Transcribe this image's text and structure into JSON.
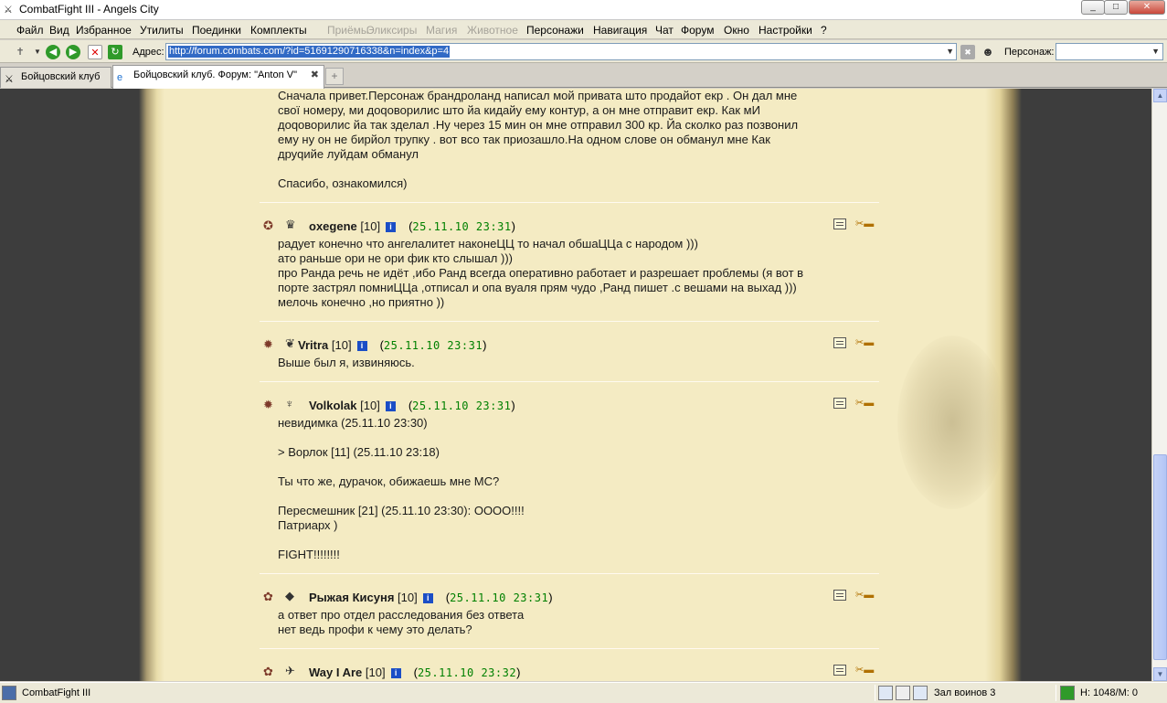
{
  "window": {
    "title": "CombatFight III - Angels City",
    "min": "_",
    "max": "□",
    "close": "✕"
  },
  "menu": {
    "items": [
      {
        "label": "Файл",
        "enabled": true
      },
      {
        "label": "Вид",
        "enabled": true
      },
      {
        "label": "Избранное",
        "enabled": true
      },
      {
        "label": "Утилиты",
        "enabled": true
      },
      {
        "label": "Поединки",
        "enabled": true
      },
      {
        "label": "Комплекты",
        "enabled": true
      },
      {
        "label": "Приёмы",
        "enabled": false
      },
      {
        "label": "Эликсиры",
        "enabled": false
      },
      {
        "label": "Магия",
        "enabled": false
      },
      {
        "label": "Животное",
        "enabled": false
      },
      {
        "label": "Персонажи",
        "enabled": true
      },
      {
        "label": "Навигация",
        "enabled": true
      },
      {
        "label": "Чат",
        "enabled": true
      },
      {
        "label": "Форум",
        "enabled": true
      },
      {
        "label": "Окно",
        "enabled": true
      },
      {
        "label": "Настройки",
        "enabled": true
      },
      {
        "label": "?",
        "enabled": true
      }
    ]
  },
  "address": {
    "label": "Адрес:",
    "url": "http://forum.combats.com/?id=51691290716338&n=index&p=4",
    "character_label": "Персонаж:"
  },
  "tabs": [
    {
      "label": "Бойцовский клуб",
      "active": false
    },
    {
      "label": "Бойцовский клуб. Форум: \"Anton V\"",
      "active": true
    }
  ],
  "posts": [
    {
      "id": "p0",
      "partial": true,
      "lines": [
        "Сначала привет.Персонаж брандроланд написал мой привата што продайот екр . Он дал мне",
        "свої номеру, ми доqоворилис што йа кидайу ему контур, а он мне отправит екр. Как мИ",
        "доqоворилис йа так зделал .Ну через 15 мин он мне отправил 300 кр. Йа сколко раз позвонил",
        "ему ну он не бирйол трупку . вот всо так приозашло.На одном слове он обманул мне Как",
        "друqийе луйдам обманул",
        "",
        "Спасибо, ознакомился)"
      ]
    },
    {
      "id": "p1",
      "nick": "oxegene",
      "level": "[10]",
      "date": "25.11.10 23:31",
      "align_icon": "✪",
      "clan_icon": "♛",
      "italic": false,
      "lines": [
        "радует конечно что ангелалитет наконеЦЦ то начал обшаЦЦа с народом )))",
        "ато раньше ори не ори фик кто слышал )))",
        "про Ранда речь не идёт ,ибо Ранд всегда оперативно работает и разрешает проблемы (я вот в",
        "порте застрял помниЦЦа ,отписал и опа вуаля прям чудо ,Ранд пишет .с вешами на выхад )))",
        "мелочь конечно ,но приятно ))"
      ]
    },
    {
      "id": "p2",
      "nick": "Vritra",
      "level": "[10]",
      "date": "25.11.10 23:31",
      "align_icon": "✹",
      "clan_icon": "❦",
      "italic": false,
      "lines": [
        "Выше был я, извиняюсь."
      ]
    },
    {
      "id": "p3",
      "nick": "Volkolak",
      "level": "[10]",
      "date": "25.11.10 23:31",
      "align_icon": "✹",
      "clan_icon": "♆",
      "italic": true,
      "lines": [
        "невидимка (25.11.10 23:30)",
        "",
        "> Ворлок [11] (25.11.10 23:18)",
        "",
        "Ты что же, дурачок, обижаешь мне МС?",
        "",
        "Пересмешник [21] (25.11.10 23:30): ОООО!!!!",
        "Патриарх )",
        "",
        "FIGHT!!!!!!!!"
      ]
    },
    {
      "id": "p4",
      "nick": "Рыжая Кисуня",
      "level": "[10]",
      "date": "25.11.10 23:31",
      "align_icon": "✿",
      "clan_icon": "◆",
      "italic": false,
      "lines": [
        "а ответ про отдел расследования без ответа",
        "нет ведь профи к чему это делать?"
      ]
    },
    {
      "id": "p5",
      "nick": "Way I Are",
      "level": "[10]",
      "date": "25.11.10 23:32",
      "align_icon": "✿",
      "clan_icon": "✈",
      "italic": false,
      "lines": []
    }
  ],
  "status": {
    "app": "CombatFight III",
    "room": "Зал воинов 3",
    "hp": "H: 1048/M: 0"
  }
}
